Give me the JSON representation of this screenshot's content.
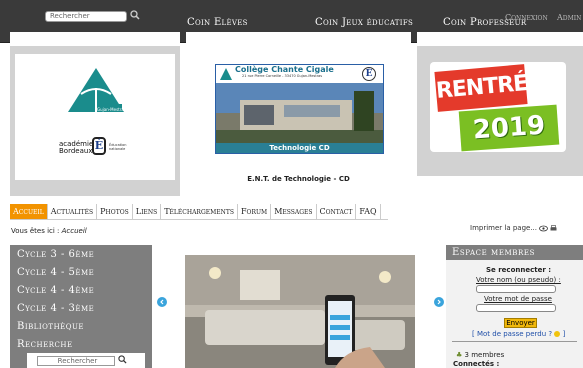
{
  "topbar": {
    "search_placeholder": "Rechercher",
    "nav": [
      "Coin Elèves",
      "Coin Jeux éducatifs",
      "Coin Professeur"
    ],
    "login_links": [
      "Connexion",
      "Admin"
    ]
  },
  "header": {
    "left_logo_text": "Gujan-Mestras",
    "academy_line1": "académie",
    "academy_line2": "Bordeaux",
    "academy_badge": "Éducation nationale",
    "school_name": "Collège Chante Cigale",
    "school_address": "21 rue Pierre Corneille - 33470 Gujan-Mestras",
    "tech_caption": "Technologie CD",
    "ent_title": "E.N.T. de Technologie - CD",
    "rentree_word": "RENTRÉE",
    "rentree_year": "2019"
  },
  "navbar": {
    "items": [
      "Accueil",
      "Actualités",
      "Photos",
      "Liens",
      "Téléchargements",
      "Forum",
      "Messages",
      "Contact",
      "FAQ"
    ]
  },
  "breadcrumb": {
    "prefix": "Vous êtes ici :",
    "current": "Accueil"
  },
  "print_label": "Imprimer la page...",
  "leftmenu": {
    "items": [
      "Cycle 3 - 6ème",
      "Cycle 4 - 5ème",
      "Cycle 4 - 4ème",
      "Cycle 4 - 3ème",
      "Bibliothèque",
      "Recherche"
    ],
    "search_placeholder": "Rechercher"
  },
  "members": {
    "title": "Espace membres",
    "reconnect": "Se reconnecter :",
    "username_label": "Votre nom (ou pseudo) :",
    "password_label": "Votre mot de passe",
    "submit": "Envoyer",
    "forgot": "[ Mot de passe perdu ? ",
    "forgot_end": " ]",
    "count": "3 membres",
    "connected": "Connectés :"
  },
  "colors": {
    "accent": "#f29300",
    "panel": "#7e7e7e",
    "topbar": "#3a3a3a",
    "link_blue": "#3aa4dc"
  }
}
